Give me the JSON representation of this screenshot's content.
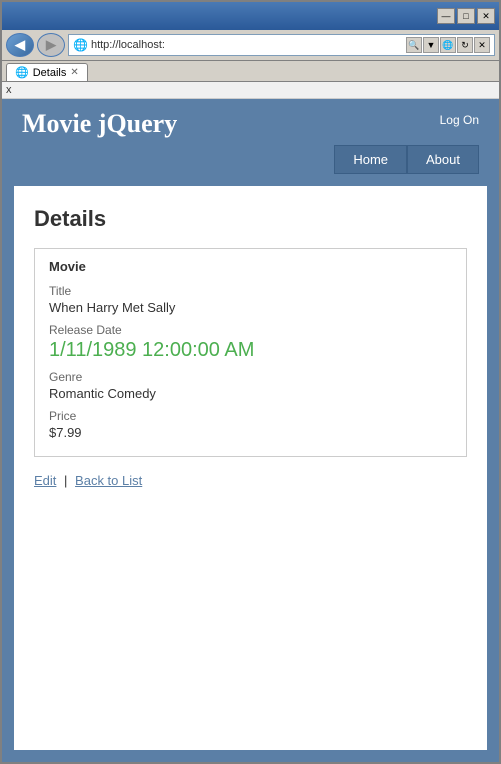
{
  "window": {
    "title": "Details",
    "title_bar_buttons": [
      "—",
      "□",
      "✕"
    ]
  },
  "browser": {
    "address": "http://localhost:",
    "tab_title": "Details",
    "tab_favicon": "🌐",
    "close_x": "x",
    "nav_back_icon": "◀",
    "nav_forward_icon": "▶",
    "addr_search_icon": "🔍",
    "addr_refresh_icon": "↻",
    "addr_stop_icon": "✕",
    "addr_dropdown": "▼"
  },
  "app": {
    "title": "Movie jQuery",
    "log_on": "Log On",
    "nav": [
      {
        "label": "Home"
      },
      {
        "label": "About"
      }
    ]
  },
  "page": {
    "title": "Details",
    "section_title": "Movie",
    "fields": [
      {
        "label": "Title",
        "value": "When Harry Met Sally",
        "type": "text"
      },
      {
        "label": "Release Date",
        "value": "1/11/1989 12:00:00 AM",
        "type": "date"
      },
      {
        "label": "Genre",
        "value": "Romantic Comedy",
        "type": "text"
      },
      {
        "label": "Price",
        "value": "$7.99",
        "type": "text"
      }
    ],
    "actions": [
      {
        "label": "Edit",
        "url": "#"
      },
      {
        "label": "Back to List",
        "url": "#"
      }
    ],
    "action_separator": "|"
  }
}
